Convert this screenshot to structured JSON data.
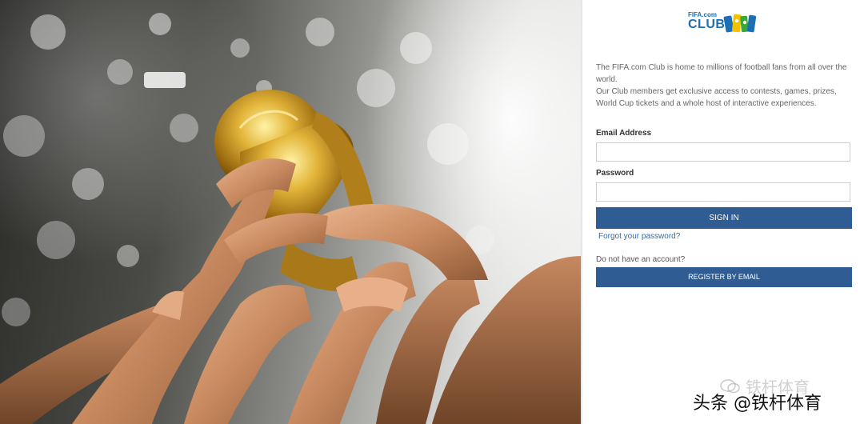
{
  "logo": {
    "top_text": "FIFA.com",
    "main_text": "CLUB",
    "colors": {
      "blue": "#1d6fb5",
      "yellow": "#f2c200",
      "green": "#39a935"
    }
  },
  "intro": {
    "line1": "The FIFA.com Club is home to millions of football fans from all over the world.",
    "line2": "Our Club members get exclusive access to contests, games, prizes, World Cup tickets and a whole host of interactive experiences."
  },
  "form": {
    "email_label": "Email Address",
    "email_value": "",
    "password_label": "Password",
    "password_value": "",
    "sign_in_label": "SIGN IN",
    "forgot_label": "Forgot your password?",
    "no_account_label": "Do not have an account?",
    "register_label": "REGISTER BY EMAIL"
  },
  "theme": {
    "primary": "#2f5d93",
    "link": "#2b6cb0"
  },
  "watermark": {
    "faint_text": "铁杆体育",
    "strong_text": "头条 @铁杆体育"
  }
}
